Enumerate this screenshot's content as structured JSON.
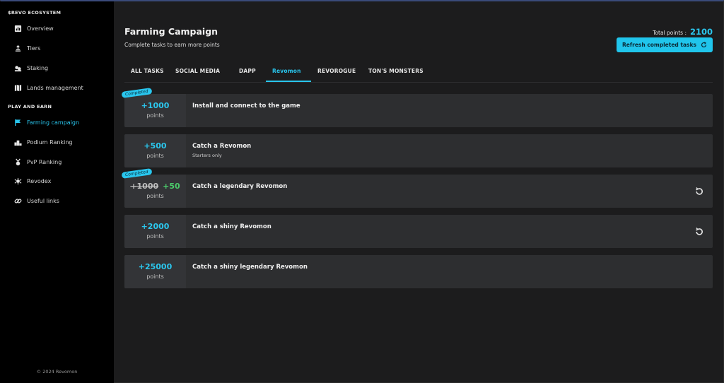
{
  "sidebar": {
    "section1": "$REVO ECOSYSTEM",
    "items1": [
      {
        "label": "Overview",
        "icon": "chart-icon"
      },
      {
        "label": "Tiers",
        "icon": "tiers-icon"
      },
      {
        "label": "Staking",
        "icon": "staking-icon"
      },
      {
        "label": "Lands management",
        "icon": "map-icon"
      }
    ],
    "section2": "PLAY AND EARN",
    "items2": [
      {
        "label": "Farming campaign",
        "icon": "flag-icon",
        "active": true
      },
      {
        "label": "Podium Ranking",
        "icon": "podium-icon"
      },
      {
        "label": "PvP Ranking",
        "icon": "medal-icon"
      },
      {
        "label": "Revodex",
        "icon": "revodex-icon"
      },
      {
        "label": "Useful links",
        "icon": "link-icon"
      }
    ],
    "footer": "© 2024 Revomon"
  },
  "header": {
    "title": "Farming Campaign",
    "subtitle": "Complete tasks to earn more points",
    "total_label": "Total points :",
    "total_value": "2100",
    "refresh_label": "Refresh completed tasks"
  },
  "tabs": [
    "ALL TASKS",
    "SOCIAL MEDIA",
    "DAPP",
    "Revomon",
    "REVOROGUE",
    "TON'S MONSTERS"
  ],
  "active_tab": "Revomon",
  "tasks": [
    {
      "points": "+1000",
      "unit": "points",
      "name": "Install and connect to the game",
      "badge": "Completed"
    },
    {
      "points": "+500",
      "unit": "points",
      "name": "Catch a Revomon",
      "sub": "Starters only"
    },
    {
      "points_old": "+1000",
      "points_new": "+50",
      "unit": "points",
      "name": "Catch a legendary Revomon",
      "badge": "Completed"
    },
    {
      "points": "+2000",
      "unit": "points",
      "name": "Catch a shiny Revomon"
    },
    {
      "points": "+25000",
      "unit": "points",
      "name": "Catch a shiny legendary Revomon"
    }
  ],
  "colors": {
    "accent": "#29c6ee",
    "green": "#4bc96a"
  }
}
